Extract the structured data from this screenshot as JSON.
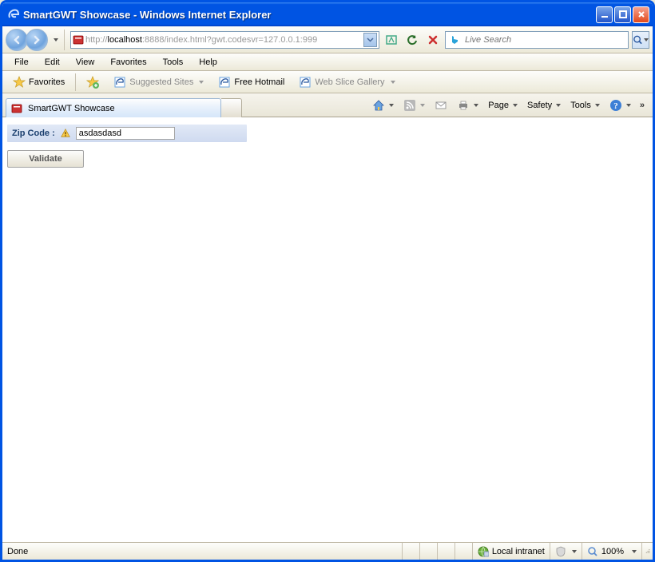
{
  "titlebar": {
    "title": "SmartGWT Showcase - Windows Internet Explorer"
  },
  "address_bar": {
    "url_gray_prefix": "http://",
    "url_host": "localhost",
    "url_gray_port": ":8888",
    "url_path": "/index.html?gwt.codesvr=127.0.0.1:999"
  },
  "search": {
    "placeholder": "Live Search"
  },
  "menu": {
    "file": "File",
    "edit": "Edit",
    "view": "View",
    "favorites": "Favorites",
    "tools": "Tools",
    "help": "Help"
  },
  "favbar": {
    "favorites": "Favorites",
    "suggested": "Suggested Sites",
    "hotmail": "Free Hotmail",
    "webslice": "Web Slice Gallery"
  },
  "tabs": {
    "tab1": "SmartGWT Showcase"
  },
  "command_bar": {
    "page": "Page",
    "safety": "Safety",
    "tools": "Tools"
  },
  "content": {
    "zip_label": "Zip Code :",
    "zip_value": "asdasdasd",
    "validate_button": "Validate"
  },
  "status": {
    "done": "Done",
    "zone": "Local intranet",
    "zoom": "100%"
  }
}
